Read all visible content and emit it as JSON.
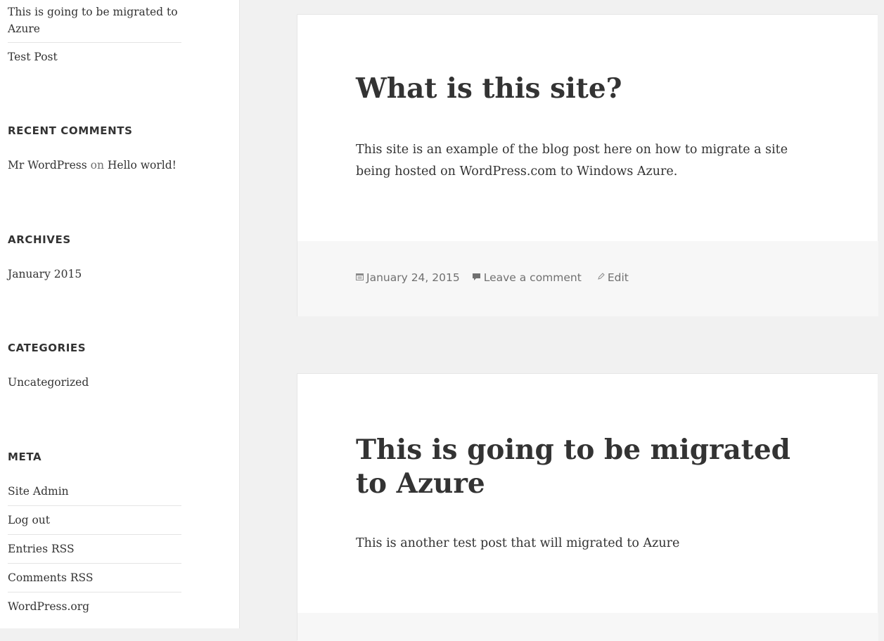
{
  "sidebar": {
    "recent_posts": [
      "This is going to be migrated to Azure",
      "Test Post"
    ],
    "recent_comments": {
      "heading": "RECENT COMMENTS",
      "author": "Mr WordPress",
      "on": "on",
      "post": "Hello world!"
    },
    "archives": {
      "heading": "ARCHIVES",
      "items": [
        "January 2015"
      ]
    },
    "categories": {
      "heading": "CATEGORIES",
      "items": [
        "Uncategorized"
      ]
    },
    "meta": {
      "heading": "META",
      "items": [
        "Site Admin",
        "Log out",
        "Entries RSS",
        "Comments RSS",
        "WordPress.org"
      ]
    }
  },
  "posts": [
    {
      "title": "What is this site?",
      "content": "This site is an example of the blog post here on how to migrate a site being hosted on WordPress.com to Windows Azure.",
      "date": "January 24, 2015",
      "comment_link": "Leave a comment",
      "edit_link": "Edit"
    },
    {
      "title": "This is going to be migrated to Azure",
      "content": "This is another test post that will migrated to Azure"
    }
  ],
  "icons": {
    "date": "calendar-icon",
    "comment": "comment-icon",
    "edit": "pencil-icon"
  }
}
